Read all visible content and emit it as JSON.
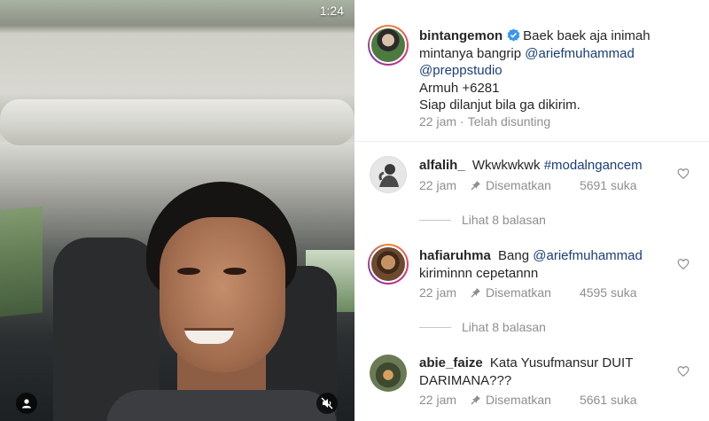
{
  "video": {
    "timer": "1:24"
  },
  "caption": {
    "username": "bintangemon",
    "text_part1": "Baek baek aja inimah mintanya bangrip",
    "mention1": "@ariefmuhammad",
    "mention2": "@preppstudio",
    "line3": "Armuh +6281",
    "line4": "Siap dilanjut bila ga dikirim.",
    "time": "22 jam",
    "edited": "Telah disunting"
  },
  "comments": [
    {
      "username": "alfalih_",
      "text": "Wkwkwkwk",
      "hashtag": "#modalngancem",
      "time": "22 jam",
      "pinned": "Disematkan",
      "likes": "5691 suka",
      "replies": "Lihat 8 balasan"
    },
    {
      "username": "hafiaruhma",
      "text": "Bang",
      "mention": "@ariefmuhammad",
      "text2": "kiriminnn cepetannn",
      "time": "22 jam",
      "pinned": "Disematkan",
      "likes": "4595 suka",
      "replies": "Lihat 8 balasan"
    },
    {
      "username": "abie_faize",
      "text": "Kata Yusufmansur DUIT DARIMANA???",
      "time": "22 jam",
      "pinned": "Disematkan",
      "likes": "5661 suka"
    }
  ],
  "colors": {
    "mention": "#1a3e7a",
    "meta": "#8e8e8e",
    "verified": "#3897f0"
  },
  "icons": [
    "user-icon",
    "mute-icon",
    "verified-icon",
    "pin-icon",
    "heart-icon"
  ]
}
